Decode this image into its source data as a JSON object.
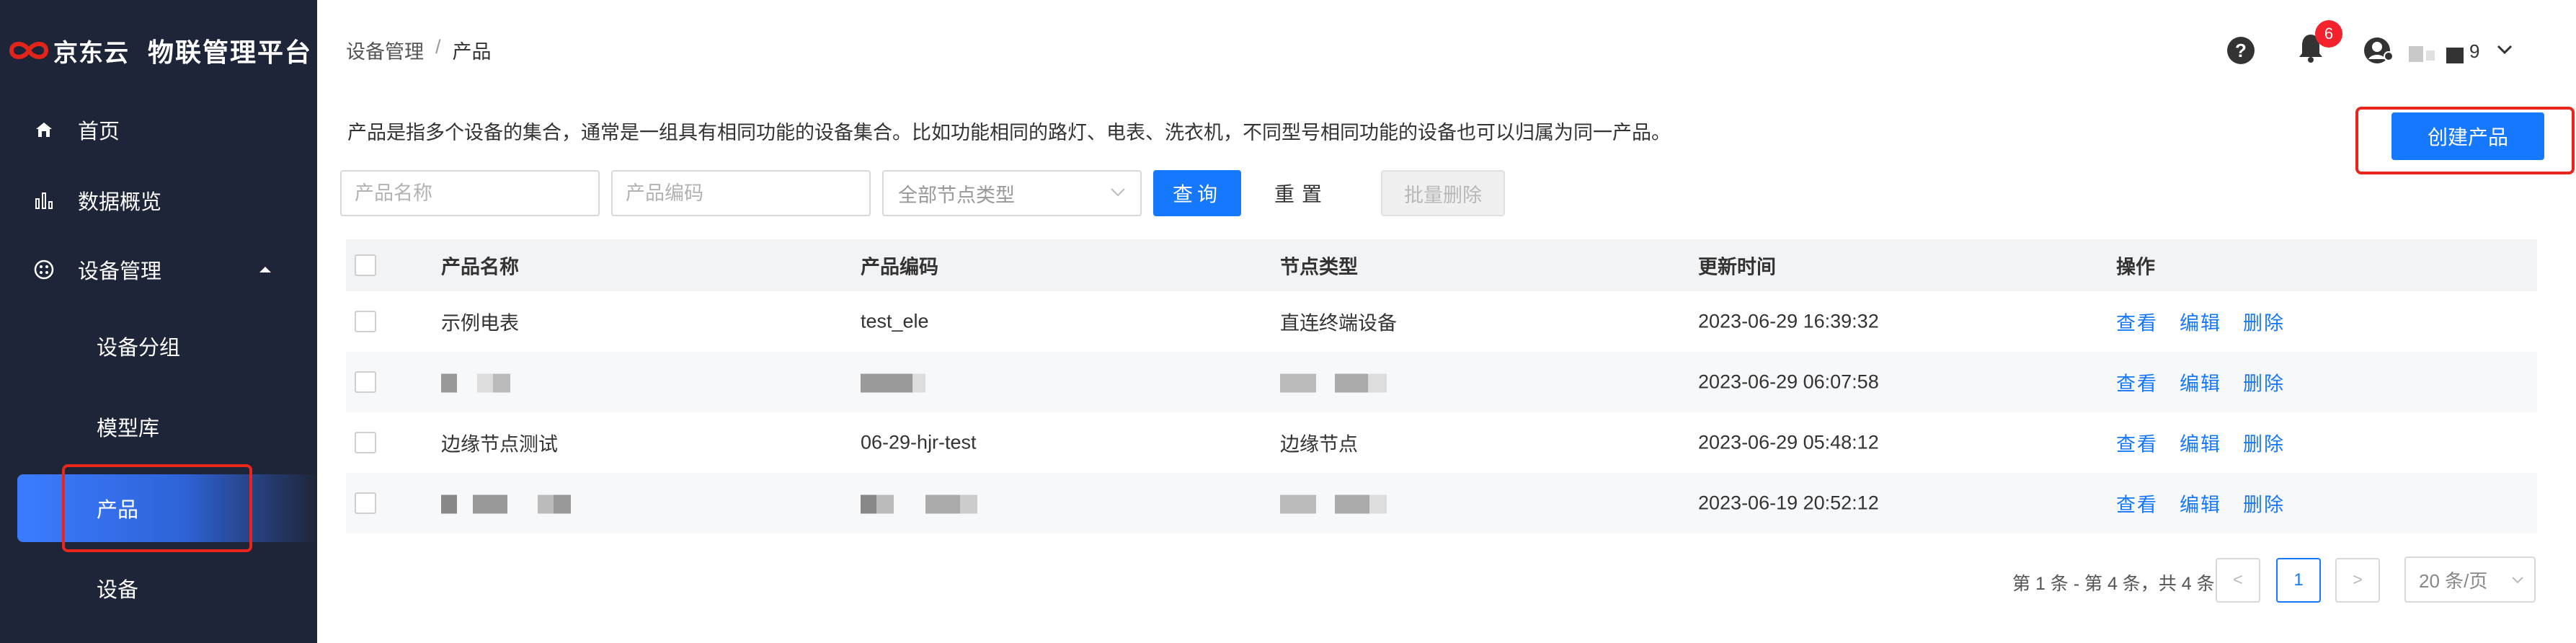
{
  "brand": {
    "logo_text": "京东云",
    "title": "物联管理平台"
  },
  "sidebar": {
    "items": [
      {
        "label": "首页",
        "icon": "home-icon"
      },
      {
        "label": "数据概览",
        "icon": "bar-chart-icon"
      },
      {
        "label": "设备管理",
        "icon": "device-manage-icon",
        "expanded": true
      },
      {
        "label": "设备分组"
      },
      {
        "label": "模型库"
      },
      {
        "label": "产品",
        "active": true
      },
      {
        "label": "设备"
      }
    ]
  },
  "header": {
    "breadcrumb": [
      "设备管理",
      "产品"
    ],
    "breadcrumb_sep": "/",
    "help_icon": "?",
    "notification_count": "6",
    "user_name_suffix": "9"
  },
  "main": {
    "description": "产品是指多个设备的集合，通常是一组具有相同功能的设备集合。比如功能相同的路灯、电表、洗衣机，不同型号相同功能的设备也可以归属为同一产品。",
    "create_button": "创建产品",
    "filters": {
      "name_placeholder": "产品名称",
      "code_placeholder": "产品编码",
      "node_type_placeholder": "全部节点类型",
      "query_button": "查询",
      "reset_button": "重置",
      "batch_delete_button": "批量删除"
    },
    "table": {
      "headers": [
        "产品名称",
        "产品编码",
        "节点类型",
        "更新时间",
        "操作"
      ],
      "rows": [
        {
          "name": "示例电表",
          "code": "test_ele",
          "node_type": "直连终端设备",
          "updated": "2023-06-29 16:39:32",
          "blurred": false
        },
        {
          "name": "",
          "code": "",
          "node_type": "",
          "updated": "2023-06-29 06:07:58",
          "blurred": true
        },
        {
          "name": "边缘节点测试",
          "code": "06-29-hjr-test",
          "node_type": "边缘节点",
          "updated": "2023-06-29 05:48:12",
          "blurred": false
        },
        {
          "name": "",
          "code": "",
          "node_type": "",
          "updated": "2023-06-19 20:52:12",
          "blurred": true
        }
      ],
      "actions": [
        "查看",
        "编辑",
        "删除"
      ]
    },
    "pagination": {
      "total_text": "第 1 条 - 第 4 条，共 4 条",
      "current_page": "1",
      "prev": "<",
      "next": ">",
      "page_size": "20 条/页"
    }
  },
  "colors": {
    "sidebar_bg": "#1f2538",
    "primary": "#1677ff",
    "highlight": "#e8261b",
    "badge": "#f5222d"
  }
}
